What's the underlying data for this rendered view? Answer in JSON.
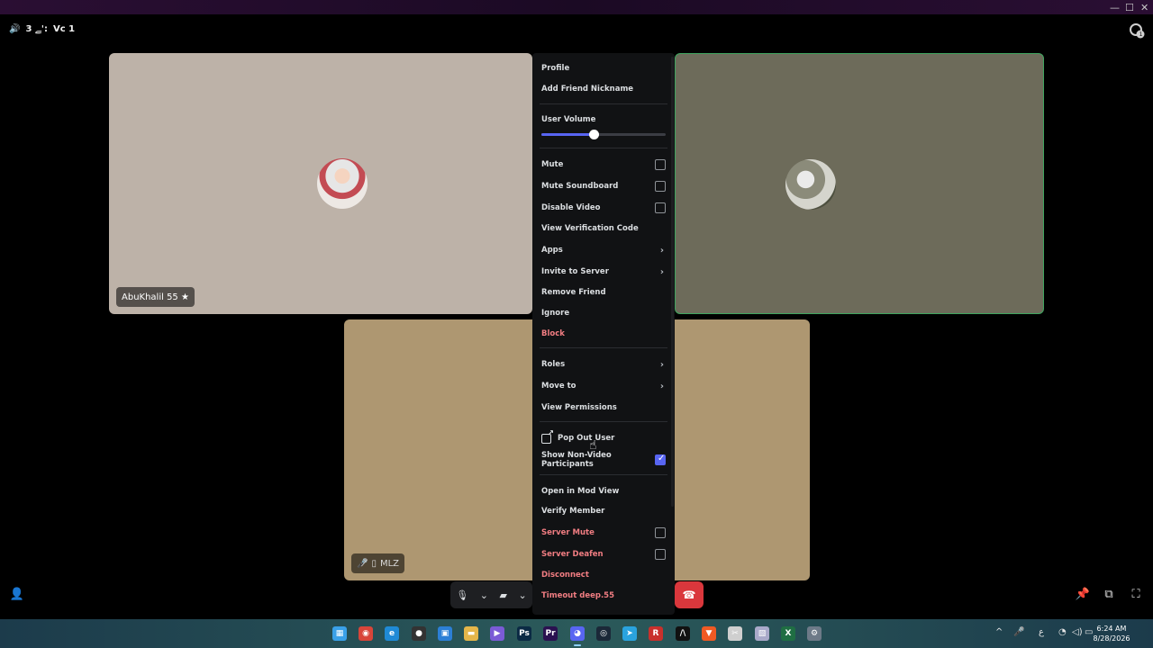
{
  "window": {
    "minimize": "—",
    "maximize": "☐",
    "close": "✕"
  },
  "header": {
    "speaker_glyph": "🔊",
    "channel_label": "Vc 1",
    "prefix": "ﮯ 3':"
  },
  "tiles": [
    {
      "name": "AbuKhalil 55 ★"
    },
    {
      "name": ""
    },
    {
      "name": "MLZ",
      "muted_glyph": "🎤̸",
      "device_glyph": "▯"
    }
  ],
  "menu": {
    "items": [
      {
        "label": "Profile"
      },
      {
        "label": "Add Friend Nickname"
      },
      {
        "label": "User Volume"
      },
      {
        "label": "Mute"
      },
      {
        "label": "Mute Soundboard"
      },
      {
        "label": "Disable Video"
      },
      {
        "label": "View Verification Code"
      },
      {
        "label": "Apps"
      },
      {
        "label": "Invite to Server"
      },
      {
        "label": "Remove Friend"
      },
      {
        "label": "Ignore"
      },
      {
        "label": "Block"
      },
      {
        "label": "Roles"
      },
      {
        "label": "Move to"
      },
      {
        "label": "View Permissions"
      },
      {
        "label": "Pop Out User"
      },
      {
        "label": "Show Non-Video Participants"
      },
      {
        "label": "Open in Mod View"
      },
      {
        "label": "Verify Member"
      },
      {
        "label": "Server Mute"
      },
      {
        "label": "Server Deafen"
      },
      {
        "label": "Disconnect"
      },
      {
        "label": "Timeout deep.55"
      }
    ],
    "user_volume_fraction": 0.42,
    "show_non_video_checked": true,
    "arrow_glyph": "›"
  },
  "controls": {
    "mic_glyph": "🎙",
    "chevron": "⌄",
    "camera_off_glyph": "▰",
    "hangup_glyph": "☎"
  },
  "corner": {
    "invite_glyph": "👤",
    "pin_glyph": "📌",
    "popout_glyph": "⧉",
    "fullscreen_glyph": "⛶"
  },
  "taskbar": {
    "icons": [
      {
        "name": "file-explorer-icon",
        "glyph": "▦",
        "color": "#3aa0e8"
      },
      {
        "name": "chrome-icon",
        "glyph": "◉",
        "color": "#d8453a"
      },
      {
        "name": "edge-icon",
        "glyph": "e",
        "color": "#1f8ad6"
      },
      {
        "name": "github-icon",
        "glyph": "●",
        "color": "#333333"
      },
      {
        "name": "store-icon",
        "glyph": "▣",
        "color": "#2c7fd6"
      },
      {
        "name": "folder-icon",
        "glyph": "▬",
        "color": "#e5b64a"
      },
      {
        "name": "media-icon",
        "glyph": "▶",
        "color": "#7b5bd6"
      },
      {
        "name": "photoshop-icon",
        "glyph": "Ps",
        "color": "#0b2a44"
      },
      {
        "name": "premiere-icon",
        "glyph": "Pr",
        "color": "#2a1150"
      },
      {
        "name": "discord-icon",
        "glyph": "◕",
        "color": "#5865f2"
      },
      {
        "name": "steam-icon",
        "glyph": "◎",
        "color": "#1b2838"
      },
      {
        "name": "telegram-icon",
        "glyph": "➤",
        "color": "#2aa3de"
      },
      {
        "name": "app-red-icon",
        "glyph": "R",
        "color": "#c9302c"
      },
      {
        "name": "capcut-icon",
        "glyph": "/\\",
        "color": "#111111"
      },
      {
        "name": "brave-icon",
        "glyph": "▼",
        "color": "#f05a24"
      },
      {
        "name": "snipping-icon",
        "glyph": "✂",
        "color": "#cfcfcf"
      },
      {
        "name": "photos-icon",
        "glyph": "▧",
        "color": "#a9a9c9"
      },
      {
        "name": "excel-icon",
        "glyph": "X",
        "color": "#1f6e43"
      },
      {
        "name": "settings-icon",
        "glyph": "⚙",
        "color": "#6d7a88"
      }
    ],
    "tray": {
      "chevron": "^",
      "mic": "🎤",
      "lang": "ع",
      "wifi": "◔",
      "volume": "◁)",
      "battery": "▭"
    },
    "clock_time": "6:24 AM",
    "clock_date": "8/28/2026"
  }
}
